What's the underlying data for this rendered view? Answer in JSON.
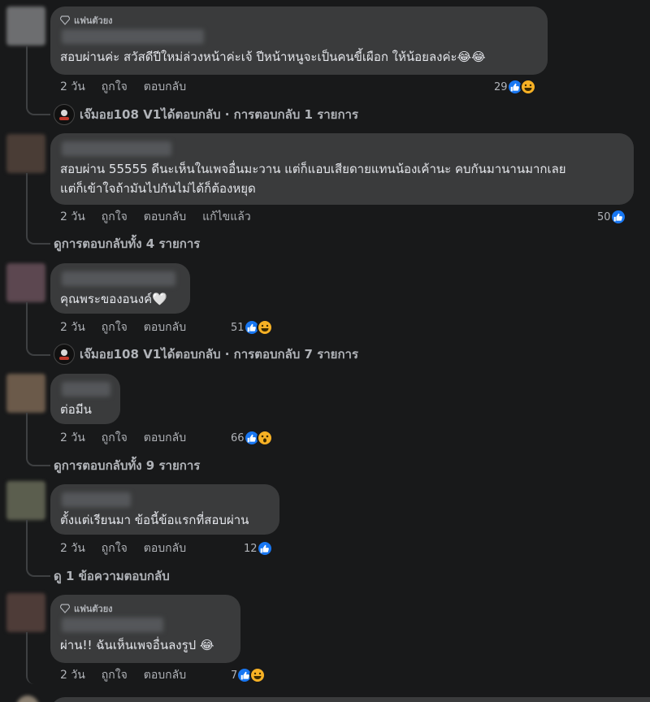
{
  "badge_label": "แฟนตัวยง",
  "actions": {
    "day": "2 วัน",
    "like": "ถูกใจ",
    "reply": "ตอบกลับ",
    "edited": "แก้ไขแล้ว"
  },
  "comments": [
    {
      "text": "สอบผ่านค่ะ สวัสดีปีใหม่ล่วงหน้าค่ะเจ้ ปีหน้าหนูจะเป็นคนขี้เผือก ให้น้อยลงค่ะ😂😂",
      "reactions": "29",
      "reply": {
        "name": "เจ๊มอย108 V1",
        "text": " ได้ตอบกลับ · การตอบกลับ 1 รายการ"
      }
    },
    {
      "text1": "สอบผ่าน 55555 ดีนะเห็นในเพจอื่นมะวาน แต่ก็แอบเสียดายแทนน้องเค้านะ คบกันมานานมากเลย",
      "text2": "แต่ก็เข้าใจถ้ามันไปกันไม่ได้ก็ต้องหยุด",
      "reactions": "50",
      "reply": "ดูการตอบกลับทั้ง 4 รายการ"
    },
    {
      "text": "คุณพระของอนงค์🤍",
      "reactions": "51",
      "reply": {
        "name": "เจ๊มอย108 V1",
        "text": " ได้ตอบกลับ · การตอบกลับ 7 รายการ"
      }
    },
    {
      "text": "ต่อมีน",
      "reactions": "66",
      "reply": "ดูการตอบกลับทั้ง 9 รายการ"
    },
    {
      "text": "ตั้งแต่เรียนมา ข้อนี้ข้อแรกที่สอบผ่าน",
      "reactions": "12",
      "reply": "ดู 1 ข้อความตอบกลับ"
    },
    {
      "text": "ผ่าน!! ฉันเห็นเพจอื่นลงรูป 😂",
      "reactions": "7"
    }
  ],
  "colors": {
    "bg": "#18191a",
    "bubble": "#3a3b3c",
    "like": "#1877f2",
    "emoji": "#f7b125"
  }
}
